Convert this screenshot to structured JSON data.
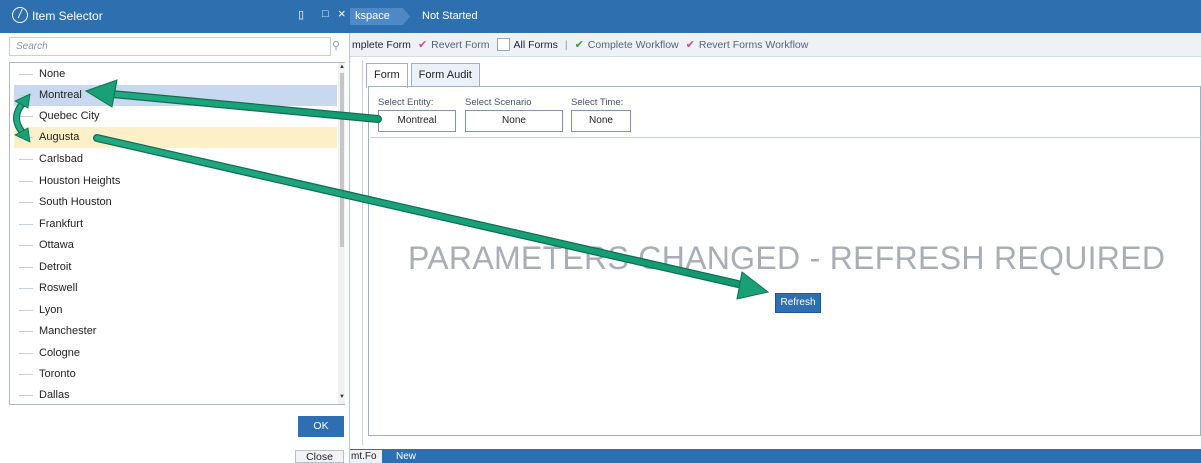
{
  "workspace": {
    "breadcrumb": [
      "kspace",
      "Not Started"
    ],
    "toolbar": {
      "complete_form": "mplete Form",
      "revert_form": "Revert Form",
      "all_forms": "All Forms",
      "separator": "|",
      "complete_workflow": "Complete Workflow",
      "revert_forms_workflow": "Revert Forms Workflow"
    },
    "tabs": [
      "Form",
      "Form Audit"
    ],
    "params": {
      "entity_label": "Select Entity:",
      "scenario_label": "Select Scenario",
      "time_label": "Select Time:",
      "entity_value": "Montreal",
      "scenario_value": "None",
      "time_value": "None"
    },
    "message": "PARAMETERS CHANGED - REFRESH REQUIRED",
    "refresh_label": "Refresh",
    "bottom": {
      "tab_label": "mt.Fo",
      "new_label": "New"
    }
  },
  "dialog": {
    "title": "Item Selector",
    "pin_icon": "▯",
    "maximize_icon": "□",
    "close_icon": "×",
    "search_placeholder": "Search",
    "items": [
      "None",
      "Montreal",
      "Quebec City",
      "Augusta",
      "Carlsbad",
      "Houston Heights",
      "South Houston",
      "Frankfurt",
      "Ottawa",
      "Detroit",
      "Roswell",
      "Lyon",
      "Manchester",
      "Cologne",
      "Toronto",
      "Dallas"
    ],
    "selected_item": "Montreal",
    "hovered_item": "Augusta",
    "ok_label": "OK",
    "close_label": "Close"
  },
  "colors": {
    "titlebar": "#2e6fb0",
    "selection": "#c8d8ef",
    "hover": "#fdf0c8",
    "arrow": "#1aa37a"
  },
  "icons": [
    "logo-icon",
    "pin-icon",
    "maximize-icon",
    "close-icon",
    "binoculars-icon",
    "checkmark-icon",
    "revert-icon",
    "checkbox-icon"
  ]
}
